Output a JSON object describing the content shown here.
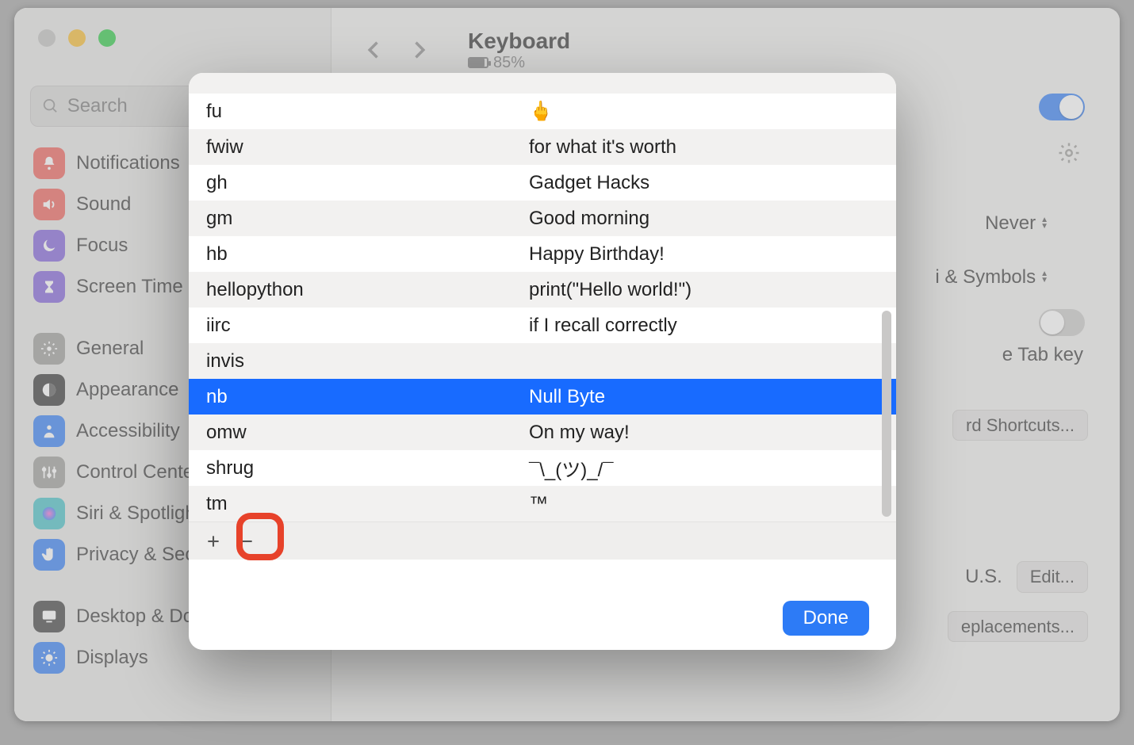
{
  "window": {
    "title": "Keyboard",
    "battery_text": "85%",
    "search_placeholder": "Search"
  },
  "sidebar": {
    "items": [
      {
        "label": "Notifications",
        "icon_bg": "#ef5c55",
        "icon": "bell"
      },
      {
        "label": "Sound",
        "icon_bg": "#ef5c55",
        "icon": "speaker"
      },
      {
        "label": "Focus",
        "icon_bg": "#7d5bd9",
        "icon": "moon"
      },
      {
        "label": "Screen Time",
        "icon_bg": "#7d5bd9",
        "icon": "hourglass"
      },
      {
        "label": "General",
        "icon_bg": "#9a9996",
        "icon": "gear"
      },
      {
        "label": "Appearance",
        "icon_bg": "#2e2e2e",
        "icon": "appearance"
      },
      {
        "label": "Accessibility",
        "icon_bg": "#2d7bf6",
        "icon": "person"
      },
      {
        "label": "Control Cente",
        "icon_bg": "#9a9996",
        "icon": "sliders"
      },
      {
        "label": "Siri & Spotligh",
        "icon_bg": "#41c0c5",
        "icon": "siri"
      },
      {
        "label": "Privacy & Sec",
        "icon_bg": "#2d7bf6",
        "icon": "hand"
      },
      {
        "label": "Desktop & Dock",
        "icon_bg": "#3a3a3a",
        "icon": "desktop"
      },
      {
        "label": "Displays",
        "icon_bg": "#2d7bf6",
        "icon": "brightness"
      }
    ]
  },
  "background_controls": {
    "never_label": "Never",
    "symbols_label": "i & Symbols",
    "tab_key_text": "e Tab key",
    "shortcuts_btn": "rd Shortcuts...",
    "us_label": "U.S.",
    "edit_btn": "Edit...",
    "replacements_btn": "eplacements..."
  },
  "sheet": {
    "rows": [
      {
        "replace": "fu",
        "with": "🖕"
      },
      {
        "replace": "fwiw",
        "with": "for what it's worth"
      },
      {
        "replace": "gh",
        "with": "Gadget Hacks"
      },
      {
        "replace": "gm",
        "with": "Good morning"
      },
      {
        "replace": "hb",
        "with": "Happy Birthday!"
      },
      {
        "replace": "hellopython",
        "with": "print(\"Hello world!\")"
      },
      {
        "replace": "iirc",
        "with": "if I recall correctly"
      },
      {
        "replace": "invis",
        "with": ""
      },
      {
        "replace": "nb",
        "with": "Null Byte",
        "selected": true
      },
      {
        "replace": "omw",
        "with": "On my way!"
      },
      {
        "replace": "shrug",
        "with": "¯\\_(ツ)_/¯"
      },
      {
        "replace": "tm",
        "with": "™"
      }
    ],
    "done": "Done"
  }
}
